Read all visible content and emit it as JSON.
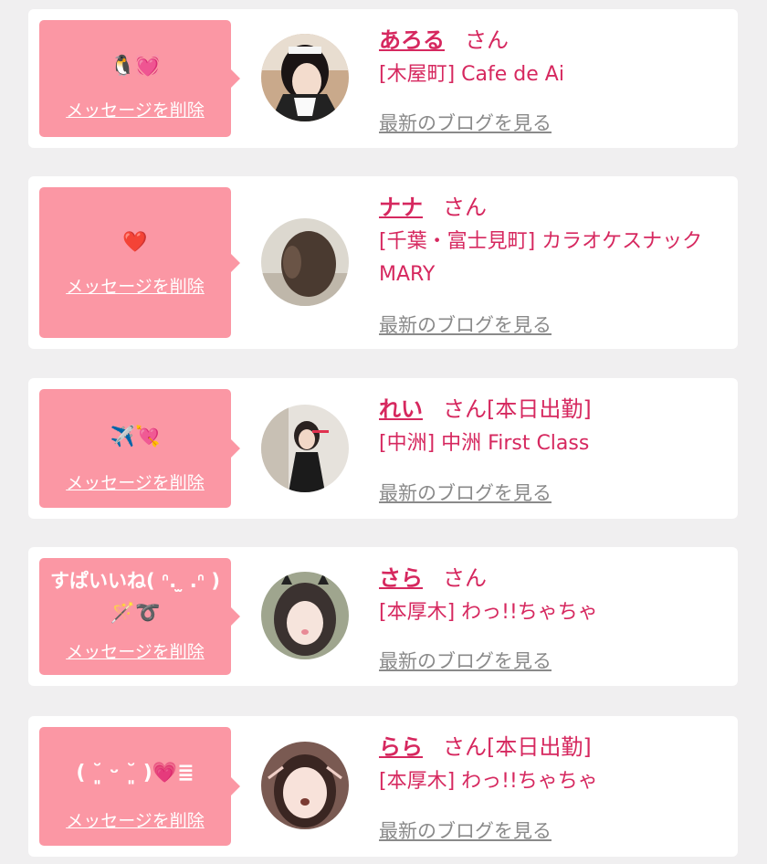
{
  "colors": {
    "accent": "#d6285f",
    "bubble": "#fb97a4",
    "link_gray": "#8a8a8a"
  },
  "delete_label": "メッセージを削除",
  "blog_label": "最新のブログを見る",
  "honorific": "さん",
  "messages": [
    {
      "message": "🐧💓",
      "name": "あろる",
      "status": "",
      "shop": "[木屋町] Cafe de Ai"
    },
    {
      "message": "❤️",
      "name": "ナナ",
      "status": "",
      "shop": "[千葉・富士見町] カラオケスナック MARY"
    },
    {
      "message": "✈️💘",
      "name": "れい",
      "status": "[本日出勤]",
      "shop": "[中洲] 中洲 First Class"
    },
    {
      "message_line1": "すぱいいね( ᐢ. ̫ .ᐢ )",
      "message_line2": "🪄➰",
      "name": "さら",
      "status": "",
      "shop": "[本厚木] わっ!!ちゃちゃ"
    },
    {
      "message": "( ˘͈ ᵕ ˘͈ )💗≣",
      "name": "らら",
      "status": "[本日出勤]",
      "shop": "[本厚木] わっ!!ちゃちゃ"
    }
  ]
}
